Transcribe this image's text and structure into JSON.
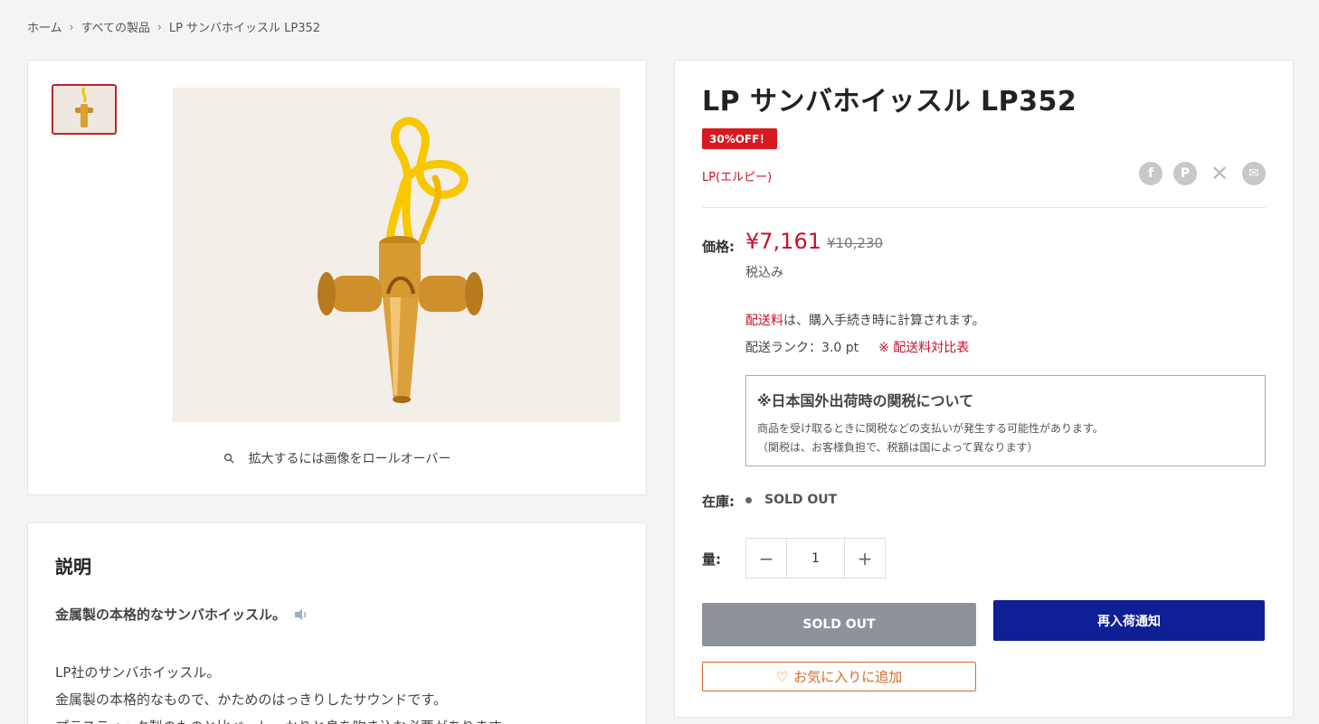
{
  "breadcrumb": {
    "home": "ホーム",
    "all": "すべての製品",
    "current": "LP サンバホイッスル LP352",
    "sep": "›"
  },
  "gallery": {
    "zoom_hint": "拡大するには画像をロールオーバー"
  },
  "description": {
    "title": "説明",
    "lead": "金属製の本格的なサンバホイッスル。",
    "lines": [
      "LP社のサンバホイッスル。",
      "金属製の本格的なもので、かためのはっきりしたサウンドです。",
      "プラスティック製のものと比べ、しっかりと息を吹き込む必要があります。"
    ]
  },
  "product": {
    "title": "LP サンバホイッスル LP352",
    "badge": "30%OFF！",
    "vendor": "LP(エルピー)",
    "price_label": "価格:",
    "price": "¥7,161",
    "old_price": "¥10,230",
    "tax_note": "税込み",
    "shipping_link": "配送料",
    "shipping_text": "は、購入手続き時に計算されます。",
    "shipping_rank": "配送ランク：3.0 pt",
    "shipping_table_link": "※ 配送料対比表",
    "duty": {
      "heading": "※日本国外出荷時の関税について",
      "line1": "商品を受け取るときに関税などの支払いが発生する可能性があります。",
      "line2": "（関税は、お客様負担で、税額は国によって異なります）"
    },
    "stock_label": "在庫:",
    "stock_status": "SOLD OUT",
    "qty_label": "量:",
    "qty_value": "1",
    "soldout_button": "SOLD OUT",
    "restock_button": "再入荷通知",
    "favorite_button": "お気に入りに追加"
  },
  "colors": {
    "accent_red": "#c8102e",
    "restock_blue": "#0f1f96",
    "favorite_orange": "#d86a2b"
  }
}
